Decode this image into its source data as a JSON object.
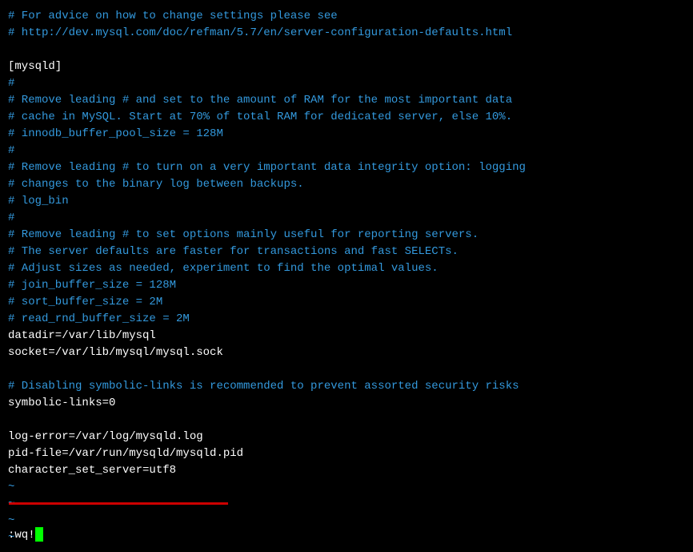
{
  "editor": {
    "lines": [
      {
        "cls": "comment",
        "text": "# For advice on how to change settings please see"
      },
      {
        "cls": "comment",
        "text": "# http://dev.mysql.com/doc/refman/5.7/en/server-configuration-defaults.html"
      },
      {
        "cls": "text",
        "text": ""
      },
      {
        "cls": "text",
        "text": "[mysqld]"
      },
      {
        "cls": "comment",
        "text": "#"
      },
      {
        "cls": "comment",
        "text": "# Remove leading # and set to the amount of RAM for the most important data"
      },
      {
        "cls": "comment",
        "text": "# cache in MySQL. Start at 70% of total RAM for dedicated server, else 10%."
      },
      {
        "cls": "comment",
        "text": "# innodb_buffer_pool_size = 128M"
      },
      {
        "cls": "comment",
        "text": "#"
      },
      {
        "cls": "comment",
        "text": "# Remove leading # to turn on a very important data integrity option: logging"
      },
      {
        "cls": "comment",
        "text": "# changes to the binary log between backups."
      },
      {
        "cls": "comment",
        "text": "# log_bin"
      },
      {
        "cls": "comment",
        "text": "#"
      },
      {
        "cls": "comment",
        "text": "# Remove leading # to set options mainly useful for reporting servers."
      },
      {
        "cls": "comment",
        "text": "# The server defaults are faster for transactions and fast SELECTs."
      },
      {
        "cls": "comment",
        "text": "# Adjust sizes as needed, experiment to find the optimal values."
      },
      {
        "cls": "comment",
        "text": "# join_buffer_size = 128M"
      },
      {
        "cls": "comment",
        "text": "# sort_buffer_size = 2M"
      },
      {
        "cls": "comment",
        "text": "# read_rnd_buffer_size = 2M"
      },
      {
        "cls": "text",
        "text": "datadir=/var/lib/mysql"
      },
      {
        "cls": "text",
        "text": "socket=/var/lib/mysql/mysql.sock"
      },
      {
        "cls": "text",
        "text": ""
      },
      {
        "cls": "comment",
        "text": "# Disabling symbolic-links is recommended to prevent assorted security risks"
      },
      {
        "cls": "text",
        "text": "symbolic-links=0"
      },
      {
        "cls": "text",
        "text": ""
      },
      {
        "cls": "text",
        "text": "log-error=/var/log/mysqld.log"
      },
      {
        "cls": "text",
        "text": "pid-file=/var/run/mysqld/mysqld.pid"
      },
      {
        "cls": "text",
        "text": "character_set_server=utf8"
      }
    ],
    "tildes": [
      "~",
      "~",
      "~",
      "~"
    ],
    "command": ":wq!"
  },
  "colors": {
    "comment": "#3399dd",
    "text": "#ffffff",
    "tilde": "#3399dd",
    "cursor": "#00ff00",
    "underline": "#cc0000",
    "bg": "#000000"
  }
}
